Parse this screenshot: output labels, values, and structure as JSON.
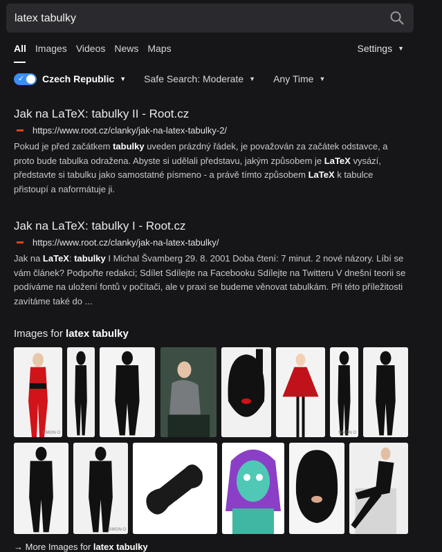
{
  "search": {
    "query": "latex tabulky"
  },
  "tabs": [
    {
      "label": "All"
    },
    {
      "label": "Images"
    },
    {
      "label": "Videos"
    },
    {
      "label": "News"
    },
    {
      "label": "Maps"
    }
  ],
  "settings_label": "Settings",
  "filters": {
    "region": "Czech Republic",
    "safe_search": "Safe Search: Moderate",
    "time": "Any Time"
  },
  "results": [
    {
      "title": "Jak na LaTeX: tabulky II - Root.cz",
      "url": "https://www.root.cz/clanky/jak-na-latex-tabulky-2/",
      "snippet_parts": [
        {
          "t": "Pokud je před začátkem ",
          "b": false
        },
        {
          "t": "tabulky",
          "b": true
        },
        {
          "t": " uveden prázdný řádek, je považován za začátek odstavce, a proto bude tabulka odražena. Abyste si udělali představu, jakým způsobem je ",
          "b": false
        },
        {
          "t": "LaTeX",
          "b": true
        },
        {
          "t": " vysází, představte si tabulku jako samostatné písmeno - a právě tímto způsobem ",
          "b": false
        },
        {
          "t": "LaTeX",
          "b": true
        },
        {
          "t": " k tabulce přistoupí a naformátuje ji.",
          "b": false
        }
      ]
    },
    {
      "title": "Jak na LaTeX: tabulky I - Root.cz",
      "url": "https://www.root.cz/clanky/jak-na-latex-tabulky/",
      "snippet_parts": [
        {
          "t": "Jak na ",
          "b": false
        },
        {
          "t": "LaTeX",
          "b": true
        },
        {
          "t": ": ",
          "b": false
        },
        {
          "t": "tabulky",
          "b": true
        },
        {
          "t": " I Michal Švamberg 29. 8. 2001 Doba čtení: 7 minut. 2 nové názory. Líbí se vám článek? Podpořte redakci; Sdílet Sdílejte na Facebooku Sdílejte na Twitteru V dnešní teorii se podíváme na uložení fontů v počítači, ale v praxi se budeme věnovat tabulkám. Při této příležitosti zavítáme také do ...",
          "b": false
        }
      ]
    }
  ],
  "images_section": {
    "prefix": "Images for ",
    "query": "latex tabulky",
    "more_prefix": "More Images for ",
    "more_query": "latex tabulky",
    "thumbnails": [
      {
        "subject": "red latex catsuit",
        "caption": "SIMON O"
      },
      {
        "subject": "black latex apron",
        "caption": ""
      },
      {
        "subject": "black latex trousers",
        "caption": ""
      },
      {
        "subject": "woman in grey latex",
        "caption": ""
      },
      {
        "subject": "black latex hood",
        "caption": ""
      },
      {
        "subject": "latex dress",
        "caption": ""
      },
      {
        "subject": "black latex suit",
        "caption": "SIMON O"
      },
      {
        "subject": "black catsuit",
        "caption": ""
      },
      {
        "subject": "black catsuit heels",
        "caption": ""
      },
      {
        "subject": "black latex outfit",
        "caption": "SIMON O"
      },
      {
        "subject": "black rubber object",
        "caption": ""
      },
      {
        "subject": "zombie costume",
        "caption": ""
      },
      {
        "subject": "black latex mask",
        "caption": ""
      },
      {
        "subject": "man in latex",
        "caption": ""
      }
    ]
  },
  "colors": {
    "background": "#161619",
    "accent": "#3b8ff0",
    "favicon": "#e0401b"
  }
}
